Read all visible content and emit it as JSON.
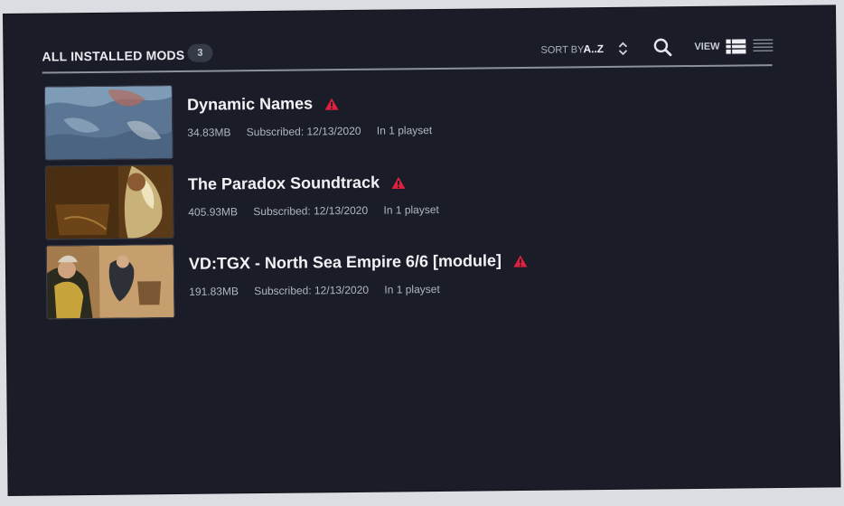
{
  "header": {
    "title": "ALL INSTALLED MODS",
    "count": "3",
    "sort_label": "SORT BY",
    "sort_value": "A..Z",
    "view_label": "VIEW"
  },
  "colors": {
    "background": "#1a1d27",
    "warning": "#e0203f",
    "badge": "#353a47"
  },
  "icons": [
    "sort-toggle-icon",
    "search-icon",
    "warning-icon",
    "view-list-icon",
    "view-compact-icon"
  ],
  "mods": [
    {
      "name": "Dynamic Names",
      "size": "34.83MB",
      "subscribed": "Subscribed: 12/13/2020",
      "playsets": "In 1 playset"
    },
    {
      "name": "The Paradox Soundtrack",
      "size": "405.93MB",
      "subscribed": "Subscribed: 12/13/2020",
      "playsets": "In 1 playset"
    },
    {
      "name": "VD:TGX - North Sea Empire 6/6 [module]",
      "size": "191.83MB",
      "subscribed": "Subscribed: 12/13/2020",
      "playsets": "In 1 playset"
    }
  ]
}
